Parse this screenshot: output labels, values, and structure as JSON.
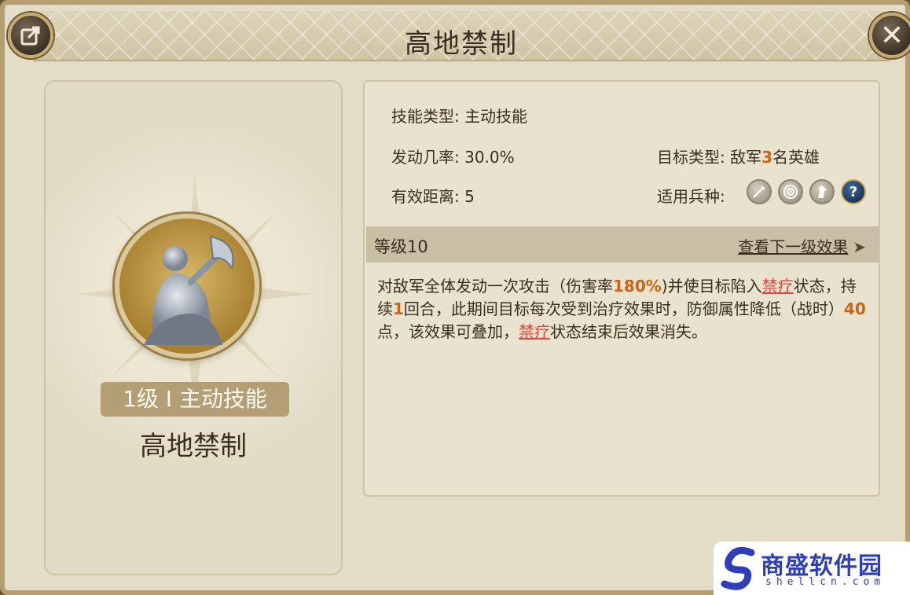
{
  "window": {
    "title": "高地禁制"
  },
  "skill": {
    "badge": "1级 I 主动技能",
    "name": "高地禁制"
  },
  "info": {
    "type_label": "技能类型:",
    "type_value": "主动技能",
    "rate_label": "发动几率:",
    "rate_value": "30.0%",
    "range_label": "有效距离:",
    "range_value": "5",
    "target_label": "目标类型:",
    "target_pre": "敌军",
    "target_count": "3",
    "target_post": "名英雄",
    "troop_label": "适用兵种:",
    "troops": [
      "sword-icon",
      "bow-target-icon",
      "horse-icon",
      "question-icon"
    ]
  },
  "level": {
    "text": "等级10",
    "next_link": "查看下一级效果"
  },
  "description": {
    "p1": "对敌军全体发动一次攻击（伤害率",
    "v1": "180%",
    "p2": ")并使目标陷入",
    "kw1": "禁疗",
    "p3": "状态，持续",
    "v2": "1",
    "p4": "回合，此期间目标每次受到治疗效果时，防御属性降低（战时）",
    "v3": "40",
    "p5": "点，该效果可叠加，",
    "kw2": "禁疗",
    "p6": "状态结束后效果消失。"
  },
  "watermark": {
    "name": "商盛软件园",
    "domain": "shellcn.com"
  },
  "colors": {
    "highlight_orange": "#c8661a",
    "keyword_red": "#e0453a"
  }
}
